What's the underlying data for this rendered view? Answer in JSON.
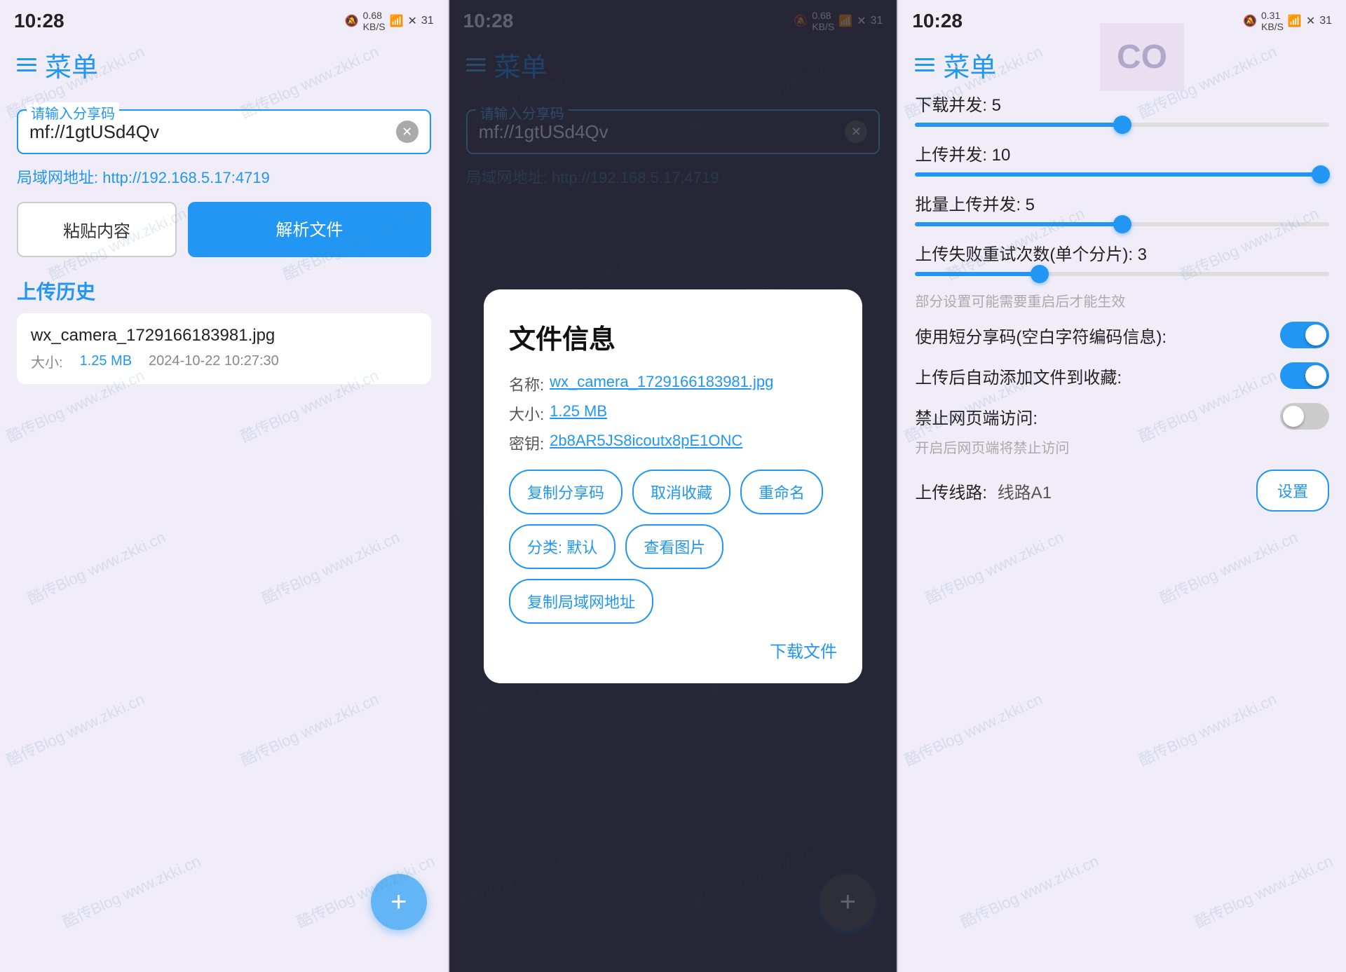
{
  "panels": [
    {
      "id": "panel1",
      "theme": "light",
      "statusBar": {
        "time": "10:28",
        "icons": "🔕 0.68 KB/S ☁ ✕ 31"
      },
      "header": {
        "title": "菜单"
      },
      "shareInput": {
        "label": "请输入分享码",
        "value": "mf://1gtUSd4Qv"
      },
      "lanAddress": "局域网地址: http://192.168.5.17:4719",
      "buttons": {
        "paste": "粘贴内容",
        "parse": "解析文件"
      },
      "uploadHistory": {
        "title": "上传历史",
        "items": [
          {
            "filename": "wx_camera_1729166183981.jpg",
            "size": "1.25 MB",
            "datetime": "2024-10-22 10:27:30"
          }
        ]
      },
      "fab": "+"
    },
    {
      "id": "panel2",
      "theme": "dark",
      "statusBar": {
        "time": "10:28",
        "icons": "🔕 0.68 KB/S ☁ ✕ 31"
      },
      "header": {
        "title": "菜单"
      },
      "shareInput": {
        "label": "请输入分享码",
        "value": "mf://1gtUSd4Qv"
      },
      "lanAddress": "局域网地址: http://192.168.5.17:4719",
      "modal": {
        "title": "文件信息",
        "fields": [
          {
            "label": "名称:",
            "value": "wx_camera_1729166183981.jpg",
            "isLink": true
          },
          {
            "label": "大小:",
            "value": "1.25 MB",
            "isLink": true
          },
          {
            "label": "密钥:",
            "value": "2b8AR5JS8icoutx8pE1ONC",
            "isLink": true
          }
        ],
        "buttons": [
          "复制分享码",
          "取消收藏",
          "重命名",
          "分类: 默认",
          "查看图片",
          "复制局域网地址"
        ],
        "downloadBtn": "下载文件"
      },
      "fab": "+"
    },
    {
      "id": "panel3",
      "theme": "light",
      "statusBar": {
        "time": "10:28",
        "icons": "🔕 0.31 KB/S ☁ ✕ 31"
      },
      "header": {
        "title": "菜单"
      },
      "settings": {
        "sliders": [
          {
            "label": "下载并发: 5",
            "value": 50,
            "thumbPos": 50
          },
          {
            "label": "上传并发: 10",
            "value": 100,
            "thumbPos": 98
          },
          {
            "label": "批量上传并发: 5",
            "value": 50,
            "thumbPos": 50
          },
          {
            "label": "上传失败重试次数(单个分片): 3",
            "value": 30,
            "thumbPos": 30
          }
        ],
        "note": "部分设置可能需要重启后才能生效",
        "toggles": [
          {
            "label": "使用短分享码(空白字符编码信息):",
            "state": "on",
            "sublabel": ""
          },
          {
            "label": "上传后自动添加文件到收藏:",
            "state": "on",
            "sublabel": ""
          },
          {
            "label": "禁止网页端访问:",
            "state": "off",
            "sublabel": "开启后网页端将禁止访问"
          }
        ],
        "routeRow": {
          "label": "上传线路:",
          "value": "线路A1",
          "btnLabel": "设置"
        }
      }
    }
  ],
  "watermarkText": "酷传Blog www.zkki.cn"
}
